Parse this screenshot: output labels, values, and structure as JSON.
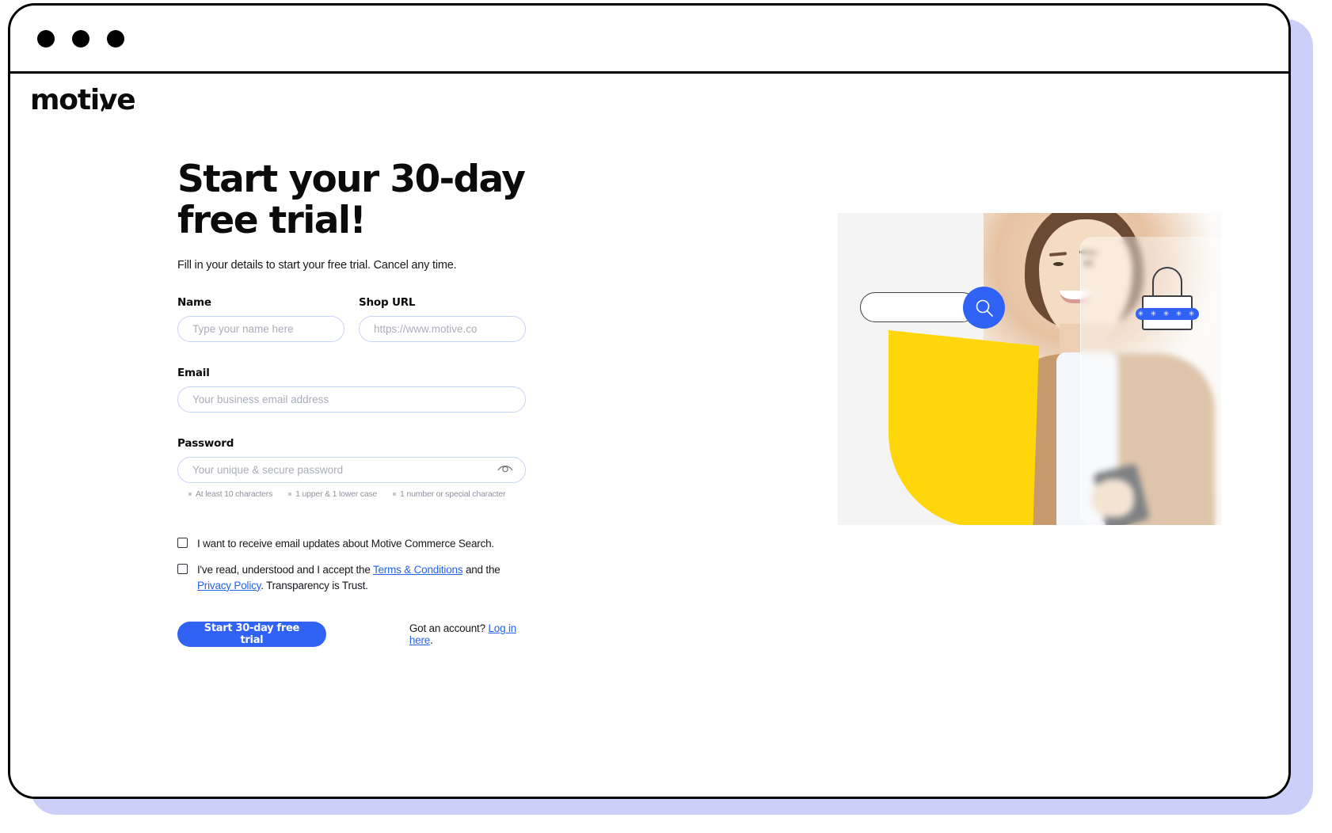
{
  "window": {
    "dots": [
      "window-dot-1",
      "window-dot-2",
      "window-dot-3"
    ]
  },
  "brand": {
    "name_part1": "moti",
    "name_part2": "v",
    "name_part3": "e",
    "full_name": "motive"
  },
  "signup": {
    "title": "Start your 30-day\nfree trial!",
    "subtitle": "Fill in your details to start your free trial. Cancel any time.",
    "fields": {
      "name": {
        "label": "Name",
        "placeholder": "Type your name here",
        "value": ""
      },
      "shop_url": {
        "label": "Shop URL",
        "placeholder": "https://www.motive.co",
        "value": ""
      },
      "email": {
        "label": "Email",
        "placeholder": "Your business email address",
        "value": ""
      },
      "password": {
        "label": "Password",
        "placeholder": "Your unique & secure password",
        "value": ""
      }
    },
    "password_rules": [
      "At least 10 characters",
      "1 upper & 1 lower case",
      "1 number or special character"
    ],
    "consent": {
      "marketing_label": "I want to receive email updates about Motive Commerce Search.",
      "terms_prefix": "I've read, understood and I accept the ",
      "terms_link": "Terms & Conditions",
      "terms_middle": " and the ",
      "privacy_link": "Privacy Policy",
      "terms_suffix": ". Transparency is Trust."
    },
    "submit_label": "Start 30-day free trial",
    "login_prompt": "Got an account? ",
    "login_link": "Log in here",
    "login_suffix": "."
  },
  "hero": {
    "search_icon": "search-icon",
    "lock_icon": "lock-icon",
    "lock_dots": "✳ ✳ ✳ ✳ ✳"
  },
  "colors": {
    "brand_blue": "#2f62f5",
    "link_blue": "#2563eb",
    "accent_yellow": "#ffd60a",
    "frame_shadow": "#ccd0f8",
    "text_dark": "#16181d",
    "placeholder_grey": "#a9aeb8",
    "input_border": "#c8d2f5"
  }
}
